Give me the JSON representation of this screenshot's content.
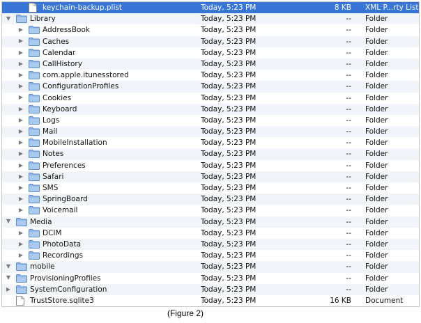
{
  "window": {
    "kind": "finder-list-view"
  },
  "colors": {
    "selection": "#3875d7",
    "folder": "#8cb4e6",
    "alt_row": "#f1f5fa"
  },
  "rows": [
    {
      "name": "keychain-backup.plist",
      "date": "Today, 5:23 PM",
      "size": "8 KB",
      "kind": "XML P...rty List",
      "type": "file",
      "depth": 1,
      "disclosure": "none",
      "selected": true
    },
    {
      "name": "Library",
      "date": "Today, 5:23 PM",
      "size": "--",
      "kind": "Folder",
      "type": "folder",
      "depth": 0,
      "disclosure": "open"
    },
    {
      "name": "AddressBook",
      "date": "Today, 5:23 PM",
      "size": "--",
      "kind": "Folder",
      "type": "folder",
      "depth": 1,
      "disclosure": "closed"
    },
    {
      "name": "Caches",
      "date": "Today, 5:23 PM",
      "size": "--",
      "kind": "Folder",
      "type": "folder",
      "depth": 1,
      "disclosure": "closed"
    },
    {
      "name": "Calendar",
      "date": "Today, 5:23 PM",
      "size": "--",
      "kind": "Folder",
      "type": "folder",
      "depth": 1,
      "disclosure": "closed"
    },
    {
      "name": "CallHistory",
      "date": "Today, 5:23 PM",
      "size": "--",
      "kind": "Folder",
      "type": "folder",
      "depth": 1,
      "disclosure": "closed"
    },
    {
      "name": "com.apple.itunesstored",
      "date": "Today, 5:23 PM",
      "size": "--",
      "kind": "Folder",
      "type": "folder",
      "depth": 1,
      "disclosure": "closed"
    },
    {
      "name": "ConfigurationProfiles",
      "date": "Today, 5:23 PM",
      "size": "--",
      "kind": "Folder",
      "type": "folder",
      "depth": 1,
      "disclosure": "closed"
    },
    {
      "name": "Cookies",
      "date": "Today, 5:23 PM",
      "size": "--",
      "kind": "Folder",
      "type": "folder",
      "depth": 1,
      "disclosure": "closed"
    },
    {
      "name": "Keyboard",
      "date": "Today, 5:23 PM",
      "size": "--",
      "kind": "Folder",
      "type": "folder",
      "depth": 1,
      "disclosure": "closed"
    },
    {
      "name": "Logs",
      "date": "Today, 5:23 PM",
      "size": "--",
      "kind": "Folder",
      "type": "folder",
      "depth": 1,
      "disclosure": "closed"
    },
    {
      "name": "Mail",
      "date": "Today, 5:23 PM",
      "size": "--",
      "kind": "Folder",
      "type": "folder",
      "depth": 1,
      "disclosure": "closed"
    },
    {
      "name": "MobileInstallation",
      "date": "Today, 5:23 PM",
      "size": "--",
      "kind": "Folder",
      "type": "folder",
      "depth": 1,
      "disclosure": "closed"
    },
    {
      "name": "Notes",
      "date": "Today, 5:23 PM",
      "size": "--",
      "kind": "Folder",
      "type": "folder",
      "depth": 1,
      "disclosure": "closed"
    },
    {
      "name": "Preferences",
      "date": "Today, 5:23 PM",
      "size": "--",
      "kind": "Folder",
      "type": "folder",
      "depth": 1,
      "disclosure": "closed"
    },
    {
      "name": "Safari",
      "date": "Today, 5:23 PM",
      "size": "--",
      "kind": "Folder",
      "type": "folder",
      "depth": 1,
      "disclosure": "closed"
    },
    {
      "name": "SMS",
      "date": "Today, 5:23 PM",
      "size": "--",
      "kind": "Folder",
      "type": "folder",
      "depth": 1,
      "disclosure": "closed"
    },
    {
      "name": "SpringBoard",
      "date": "Today, 5:23 PM",
      "size": "--",
      "kind": "Folder",
      "type": "folder",
      "depth": 1,
      "disclosure": "closed"
    },
    {
      "name": "Voicemail",
      "date": "Today, 5:23 PM",
      "size": "--",
      "kind": "Folder",
      "type": "folder",
      "depth": 1,
      "disclosure": "closed"
    },
    {
      "name": "Media",
      "date": "Today, 5:23 PM",
      "size": "--",
      "kind": "Folder",
      "type": "folder",
      "depth": 0,
      "disclosure": "open"
    },
    {
      "name": "DCIM",
      "date": "Today, 5:23 PM",
      "size": "--",
      "kind": "Folder",
      "type": "folder",
      "depth": 1,
      "disclosure": "closed"
    },
    {
      "name": "PhotoData",
      "date": "Today, 5:23 PM",
      "size": "--",
      "kind": "Folder",
      "type": "folder",
      "depth": 1,
      "disclosure": "closed"
    },
    {
      "name": "Recordings",
      "date": "Today, 5:23 PM",
      "size": "--",
      "kind": "Folder",
      "type": "folder",
      "depth": 1,
      "disclosure": "closed"
    },
    {
      "name": "mobile",
      "date": "Today, 5:23 PM",
      "size": "--",
      "kind": "Folder",
      "type": "folder",
      "depth": 0,
      "disclosure": "open"
    },
    {
      "name": "ProvisioningProfiles",
      "date": "Today, 5:23 PM",
      "size": "--",
      "kind": "Folder",
      "type": "folder",
      "depth": 0,
      "disclosure": "open"
    },
    {
      "name": "SystemConfiguration",
      "date": "Today, 5:23 PM",
      "size": "--",
      "kind": "Folder",
      "type": "folder",
      "depth": 0,
      "disclosure": "closed"
    },
    {
      "name": "TrustStore.sqlite3",
      "date": "Today, 5:23 PM",
      "size": "16 KB",
      "kind": "Document",
      "type": "file",
      "depth": 0,
      "disclosure": "none"
    }
  ],
  "caption": "(Figure  2)"
}
